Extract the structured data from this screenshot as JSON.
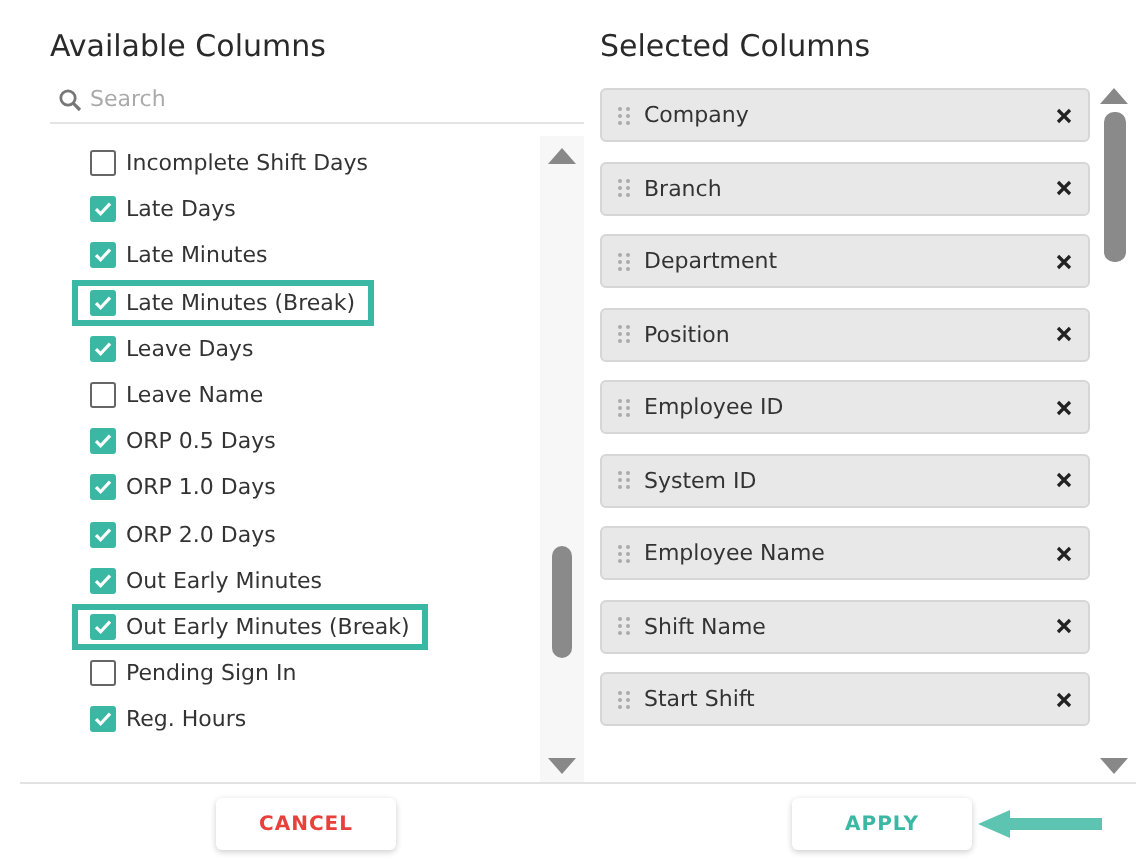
{
  "available": {
    "title": "Available Columns",
    "search": {
      "placeholder": "Search"
    },
    "items": [
      {
        "label": "Incomplete Shift Days",
        "checked": false,
        "highlighted": false
      },
      {
        "label": "Late Days",
        "checked": true,
        "highlighted": false
      },
      {
        "label": "Late Minutes",
        "checked": true,
        "highlighted": false
      },
      {
        "label": "Late Minutes (Break)",
        "checked": true,
        "highlighted": true
      },
      {
        "label": "Leave Days",
        "checked": true,
        "highlighted": false
      },
      {
        "label": "Leave Name",
        "checked": false,
        "highlighted": false
      },
      {
        "label": "ORP 0.5 Days",
        "checked": true,
        "highlighted": false
      },
      {
        "label": "ORP 1.0 Days",
        "checked": true,
        "highlighted": false
      },
      {
        "label": "ORP 2.0 Days",
        "checked": true,
        "highlighted": false
      },
      {
        "label": "Out Early Minutes",
        "checked": true,
        "highlighted": false
      },
      {
        "label": "Out Early Minutes (Break)",
        "checked": true,
        "highlighted": true
      },
      {
        "label": "Pending Sign In",
        "checked": false,
        "highlighted": false
      },
      {
        "label": "Reg. Hours",
        "checked": true,
        "highlighted": false
      }
    ]
  },
  "selected": {
    "title": "Selected Columns",
    "items": [
      "Company",
      "Branch",
      "Department",
      "Position",
      "Employee ID",
      "System ID",
      "Employee Name",
      "Shift Name",
      "Start Shift"
    ]
  },
  "buttons": [
    {
      "label": "CANCEL",
      "kind": "cancel"
    },
    {
      "label": "APPLY",
      "kind": "apply"
    }
  ]
}
